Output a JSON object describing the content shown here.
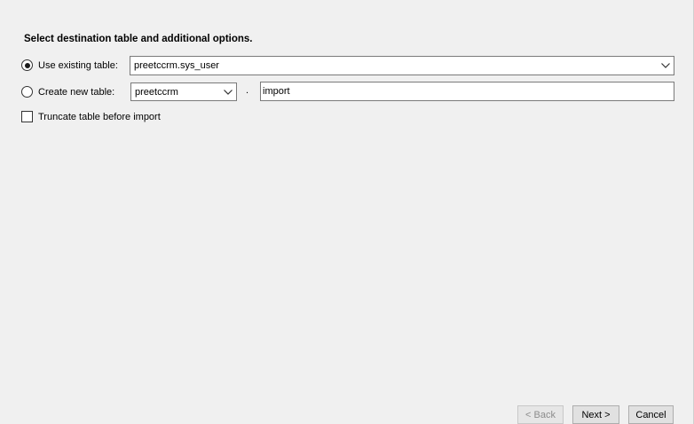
{
  "heading": "Select destination table and additional options.",
  "options": {
    "use_existing": {
      "label": "Use existing table:",
      "selected": true,
      "combo_value": "preetccrm.sys_user"
    },
    "create_new": {
      "label": "Create new table:",
      "selected": false,
      "schema_value": "preetccrm",
      "separator": ".",
      "table_name": "import"
    },
    "truncate": {
      "label": "Truncate table before import",
      "checked": false
    }
  },
  "buttons": {
    "back": "< Back",
    "next": "Next >",
    "cancel": "Cancel"
  },
  "icons": {
    "dropdown": "chevron-down-icon"
  }
}
